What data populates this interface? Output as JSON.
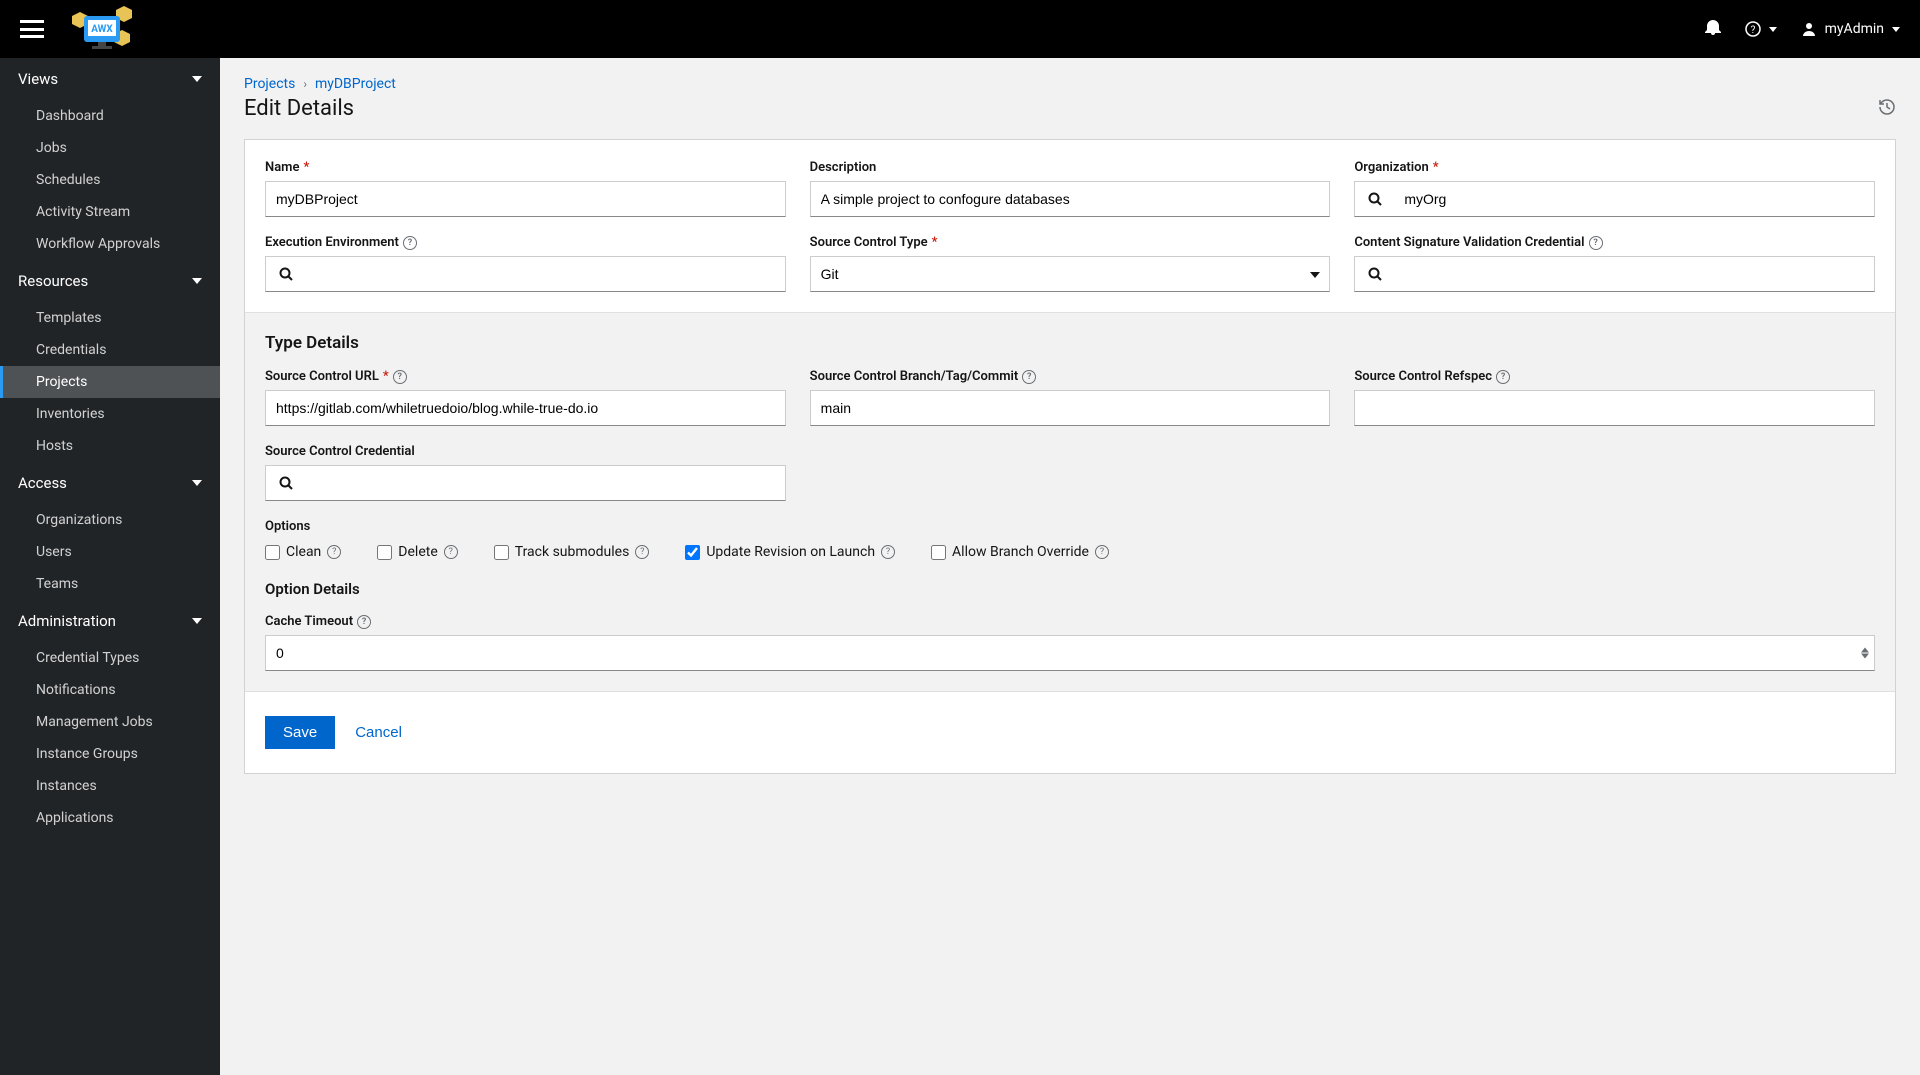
{
  "topbar": {
    "user": "myAdmin"
  },
  "sidebar": {
    "sections": [
      {
        "title": "Views",
        "items": [
          "Dashboard",
          "Jobs",
          "Schedules",
          "Activity Stream",
          "Workflow Approvals"
        ]
      },
      {
        "title": "Resources",
        "items": [
          "Templates",
          "Credentials",
          "Projects",
          "Inventories",
          "Hosts"
        ],
        "active": "Projects"
      },
      {
        "title": "Access",
        "items": [
          "Organizations",
          "Users",
          "Teams"
        ]
      },
      {
        "title": "Administration",
        "items": [
          "Credential Types",
          "Notifications",
          "Management Jobs",
          "Instance Groups",
          "Instances",
          "Applications"
        ]
      }
    ]
  },
  "breadcrumb": {
    "root": "Projects",
    "item": "myDBProject"
  },
  "page_title": "Edit Details",
  "form": {
    "name": {
      "label": "Name",
      "value": "myDBProject"
    },
    "description": {
      "label": "Description",
      "value": "A simple project to confogure databases"
    },
    "organization": {
      "label": "Organization",
      "value": "myOrg"
    },
    "exec_env": {
      "label": "Execution Environment",
      "value": ""
    },
    "sc_type": {
      "label": "Source Control Type",
      "value": "Git"
    },
    "content_sig": {
      "label": "Content Signature Validation Credential",
      "value": ""
    },
    "type_details_heading": "Type Details",
    "sc_url": {
      "label": "Source Control URL",
      "value": "https://gitlab.com/whiletruedoio/blog.while-true-do.io"
    },
    "sc_branch": {
      "label": "Source Control Branch/Tag/Commit",
      "value": "main"
    },
    "sc_refspec": {
      "label": "Source Control Refspec",
      "value": ""
    },
    "sc_credential": {
      "label": "Source Control Credential",
      "value": ""
    },
    "options_label": "Options",
    "options": {
      "clean": {
        "label": "Clean",
        "checked": false
      },
      "delete": {
        "label": "Delete",
        "checked": false
      },
      "track": {
        "label": "Track submodules",
        "checked": false
      },
      "update": {
        "label": "Update Revision on Launch",
        "checked": true
      },
      "branch_override": {
        "label": "Allow Branch Override",
        "checked": false
      }
    },
    "option_details_heading": "Option Details",
    "cache_timeout": {
      "label": "Cache Timeout",
      "value": "0"
    },
    "save": "Save",
    "cancel": "Cancel"
  }
}
